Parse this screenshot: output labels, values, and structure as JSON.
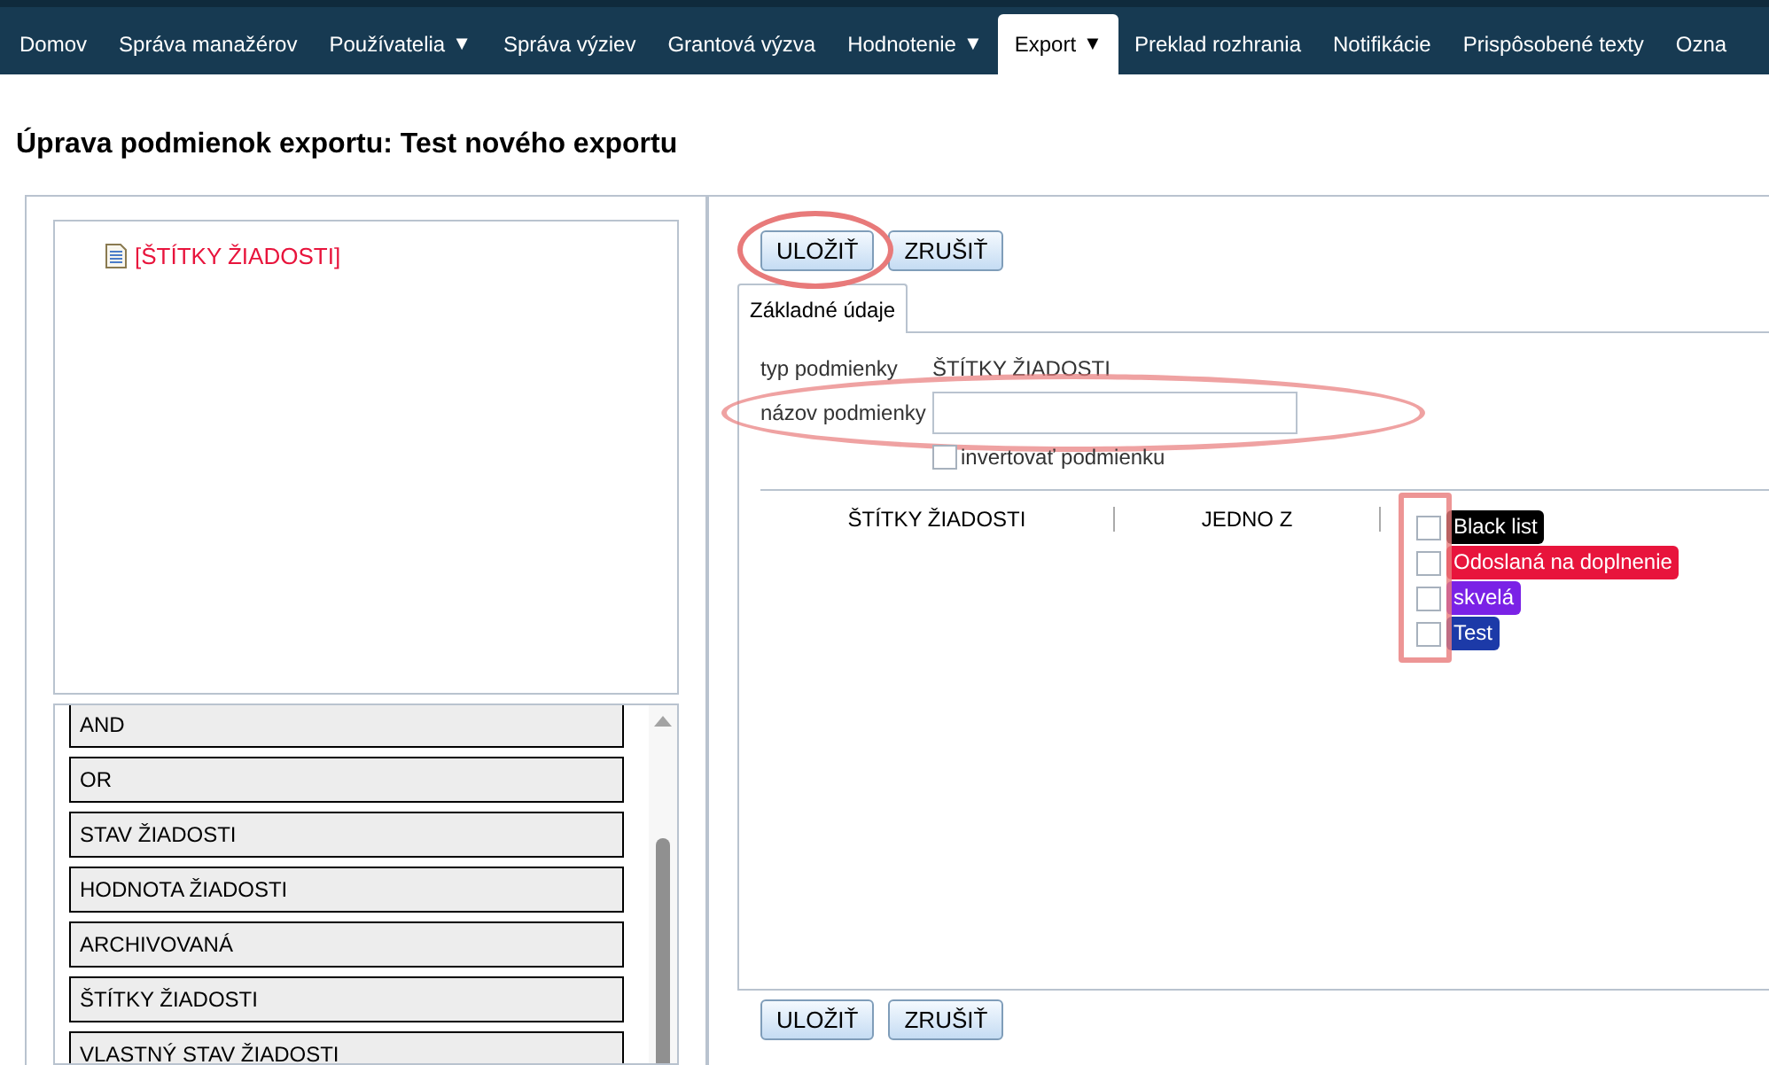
{
  "nav": {
    "items": [
      {
        "label": "Domov",
        "selected": false
      },
      {
        "label": "Správa manažérov",
        "selected": false
      },
      {
        "label": "Používatelia",
        "caret": "▼",
        "selected": false
      },
      {
        "label": "Správa výziev",
        "selected": false
      },
      {
        "label": "Grantová výzva",
        "selected": false
      },
      {
        "label": "Hodnotenie",
        "caret": "▼",
        "selected": false
      },
      {
        "label": "Export",
        "caret": "▼",
        "selected": true
      },
      {
        "label": "Preklad rozhrania",
        "selected": false
      },
      {
        "label": "Notifikácie",
        "selected": false
      },
      {
        "label": "Prispôsobené texty",
        "selected": false
      },
      {
        "label": "Ozna",
        "selected": false
      }
    ]
  },
  "page_title": "Úprava podmienok exportu: Test nového exportu",
  "tree": {
    "items": [
      {
        "label": "[ŠTÍTKY ŽIADOSTI]"
      }
    ]
  },
  "palette": {
    "items": [
      "AND",
      "OR",
      "STAV ŽIADOSTI",
      "HODNOTA ŽIADOSTI",
      "ARCHIVOVANÁ",
      "ŠTÍTKY ŽIADOSTI",
      "VLASTNÝ STAV ŽIADOSTI"
    ]
  },
  "top_buttons": [
    "ULOŽIŤ",
    "ZRUŠIŤ"
  ],
  "tabs": [
    {
      "label": "Základné údaje",
      "selected": true
    }
  ],
  "form": {
    "type_label": "typ podmienky",
    "type_value": "ŠTÍTKY ŽIADOSTI",
    "name_label": "názov podmienky",
    "invert": {
      "label": "invertovať podmienku",
      "checked": false
    }
  },
  "condition": {
    "column_1": "ŠTÍTKY ŽIADOSTI",
    "column_2": "JEDNO Z",
    "tags": [
      {
        "label": "Black list",
        "color": "#000000",
        "checked": false
      },
      {
        "label": "Odoslaná na doplnenie",
        "color": "#e8143c",
        "checked": false
      },
      {
        "label": "skvelá",
        "color": "#7a22e6",
        "checked": false
      },
      {
        "label": "Test",
        "color": "#1c3aa8",
        "checked": false
      }
    ]
  },
  "bottom_buttons": [
    "ULOŽIŤ",
    "ZRUŠIŤ"
  ]
}
